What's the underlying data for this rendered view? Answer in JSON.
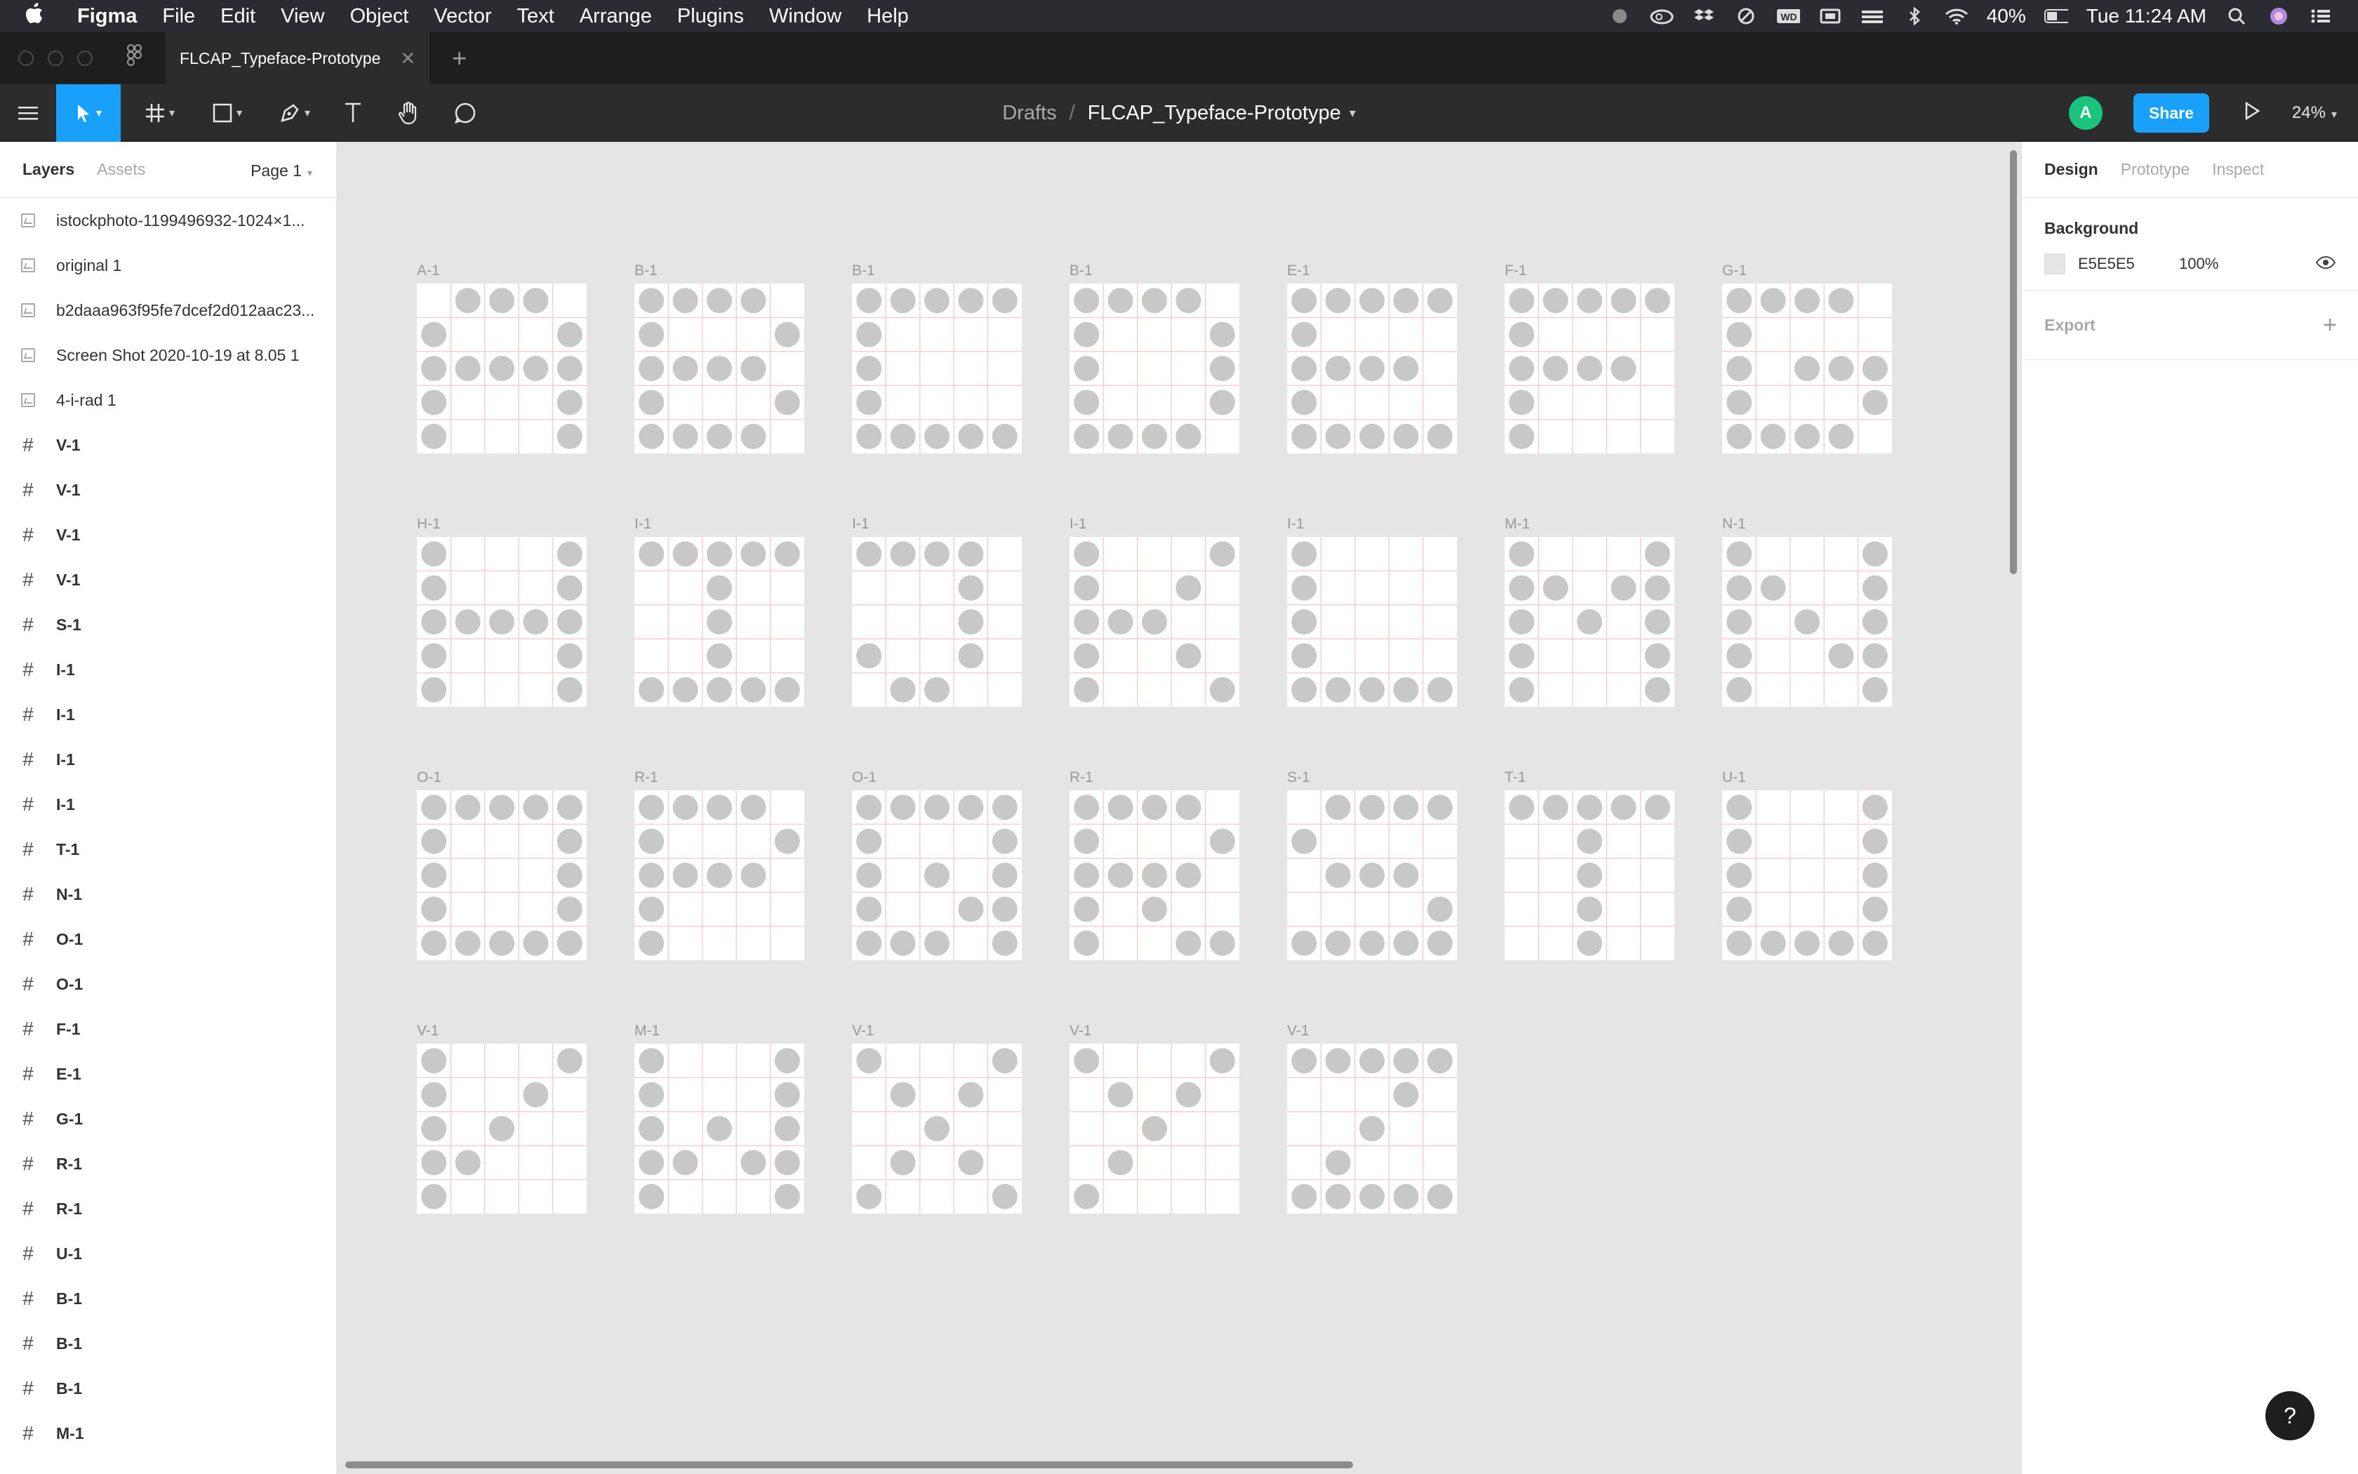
{
  "menubar": {
    "app": "Figma",
    "items": [
      "File",
      "Edit",
      "View",
      "Object",
      "Vector",
      "Text",
      "Arrange",
      "Plugins",
      "Window",
      "Help"
    ],
    "battery": "40%",
    "clock": "Tue 11:24 AM",
    "status_icons": [
      "notification-icon",
      "creative-cloud-icon",
      "dropbox-icon",
      "sync-icon",
      "wd-drive-icon",
      "display-icon",
      "menu-extra-icon",
      "bluetooth-icon",
      "wifi-icon",
      "battery-icon",
      "search-icon",
      "siri-icon",
      "control-center-icon"
    ]
  },
  "tabbar": {
    "tab_title": "FLCAP_Typeface-Prototype"
  },
  "toolbar": {
    "tools": [
      "menu-icon",
      "move-tool-icon",
      "frame-tool-icon",
      "shape-tool-icon",
      "pen-tool-icon",
      "text-tool-icon",
      "hand-tool-icon",
      "comment-tool-icon"
    ],
    "breadcrumb_root": "Drafts",
    "breadcrumb_sep": "/",
    "file_name": "FLCAP_Typeface-Prototype",
    "avatar_initial": "A",
    "share_label": "Share",
    "zoom": "24%"
  },
  "left_panel": {
    "tab_layers": "Layers",
    "tab_assets": "Assets",
    "page": "Page 1",
    "layers": [
      {
        "type": "image",
        "name": "istockphoto-1199496932-1024×1..."
      },
      {
        "type": "image",
        "name": "original 1"
      },
      {
        "type": "image",
        "name": "b2daaa963f95fe7dcef2d012aac23..."
      },
      {
        "type": "image",
        "name": "Screen Shot 2020-10-19 at 8.05 1"
      },
      {
        "type": "image",
        "name": "4-i-rad 1"
      },
      {
        "type": "frame",
        "name": "V-1"
      },
      {
        "type": "frame",
        "name": "V-1"
      },
      {
        "type": "frame",
        "name": "V-1"
      },
      {
        "type": "frame",
        "name": "V-1"
      },
      {
        "type": "frame",
        "name": "S-1"
      },
      {
        "type": "frame",
        "name": "I-1"
      },
      {
        "type": "frame",
        "name": "I-1"
      },
      {
        "type": "frame",
        "name": "I-1"
      },
      {
        "type": "frame",
        "name": "I-1"
      },
      {
        "type": "frame",
        "name": "T-1"
      },
      {
        "type": "frame",
        "name": "N-1"
      },
      {
        "type": "frame",
        "name": "O-1"
      },
      {
        "type": "frame",
        "name": "O-1"
      },
      {
        "type": "frame",
        "name": "F-1"
      },
      {
        "type": "frame",
        "name": "E-1"
      },
      {
        "type": "frame",
        "name": "G-1"
      },
      {
        "type": "frame",
        "name": "R-1"
      },
      {
        "type": "frame",
        "name": "R-1"
      },
      {
        "type": "frame",
        "name": "U-1"
      },
      {
        "type": "frame",
        "name": "B-1"
      },
      {
        "type": "frame",
        "name": "B-1"
      },
      {
        "type": "frame",
        "name": "B-1"
      },
      {
        "type": "frame",
        "name": "M-1"
      }
    ]
  },
  "right_panel": {
    "tabs": [
      "Design",
      "Prototype",
      "Inspect"
    ],
    "background_title": "Background",
    "bg_hex": "E5E5E5",
    "bg_opacity": "100%",
    "export_title": "Export"
  },
  "canvas": {
    "bg": "#e5e5e5",
    "dot_color": "#c8c8c8",
    "gridline_color": "#f6cfd4",
    "frames": [
      {
        "name": "A-1",
        "dots": [
          "01110",
          "10001",
          "11111",
          "10001",
          "10001"
        ]
      },
      {
        "name": "B-1",
        "dots": [
          "11110",
          "10001",
          "11110",
          "10001",
          "11110"
        ]
      },
      {
        "name": "B-1",
        "dots": [
          "11111",
          "10000",
          "10000",
          "10000",
          "11111"
        ]
      },
      {
        "name": "B-1",
        "dots": [
          "11110",
          "10001",
          "10001",
          "10001",
          "11110"
        ]
      },
      {
        "name": "E-1",
        "dots": [
          "11111",
          "10000",
          "11110",
          "10000",
          "11111"
        ]
      },
      {
        "name": "F-1",
        "dots": [
          "11111",
          "10000",
          "11110",
          "10000",
          "10000"
        ]
      },
      {
        "name": "G-1",
        "dots": [
          "11110",
          "10000",
          "10111",
          "10001",
          "11110"
        ]
      },
      {
        "name": "H-1",
        "dots": [
          "10001",
          "10001",
          "11111",
          "10001",
          "10001"
        ]
      },
      {
        "name": "I-1",
        "dots": [
          "11111",
          "00100",
          "00100",
          "00100",
          "11111"
        ]
      },
      {
        "name": "I-1",
        "dots": [
          "11110",
          "00010",
          "00010",
          "10010",
          "01100"
        ]
      },
      {
        "name": "I-1",
        "dots": [
          "10001",
          "10010",
          "11100",
          "10010",
          "10001"
        ]
      },
      {
        "name": "I-1",
        "dots": [
          "10000",
          "10000",
          "10000",
          "10000",
          "11111"
        ]
      },
      {
        "name": "M-1",
        "dots": [
          "10001",
          "11011",
          "10101",
          "10001",
          "10001"
        ]
      },
      {
        "name": "N-1",
        "dots": [
          "10001",
          "11001",
          "10101",
          "10011",
          "10001"
        ]
      },
      {
        "name": "O-1",
        "dots": [
          "11111",
          "10001",
          "10001",
          "10001",
          "11111"
        ]
      },
      {
        "name": "R-1",
        "dots": [
          "11110",
          "10001",
          "11110",
          "10000",
          "10000"
        ]
      },
      {
        "name": "O-1",
        "dots": [
          "11111",
          "10001",
          "10101",
          "10011",
          "11101"
        ]
      },
      {
        "name": "R-1",
        "dots": [
          "11110",
          "10001",
          "11110",
          "10100",
          "10011"
        ]
      },
      {
        "name": "S-1",
        "dots": [
          "01111",
          "10000",
          "01110",
          "00001",
          "11111"
        ]
      },
      {
        "name": "T-1",
        "dots": [
          "11111",
          "00100",
          "00100",
          "00100",
          "00100"
        ]
      },
      {
        "name": "U-1",
        "dots": [
          "10001",
          "10001",
          "10001",
          "10001",
          "11111"
        ]
      },
      {
        "name": "V-1",
        "dots": [
          "10001",
          "10010",
          "10100",
          "11000",
          "10000"
        ]
      },
      {
        "name": "M-1",
        "dots": [
          "10001",
          "10001",
          "10101",
          "11011",
          "10001"
        ]
      },
      {
        "name": "V-1",
        "dots": [
          "10001",
          "01010",
          "00100",
          "01010",
          "10001"
        ]
      },
      {
        "name": "V-1",
        "dots": [
          "10001",
          "01010",
          "00100",
          "01000",
          "10000"
        ]
      },
      {
        "name": "V-1",
        "dots": [
          "11111",
          "00010",
          "00100",
          "01000",
          "11111"
        ]
      }
    ]
  }
}
